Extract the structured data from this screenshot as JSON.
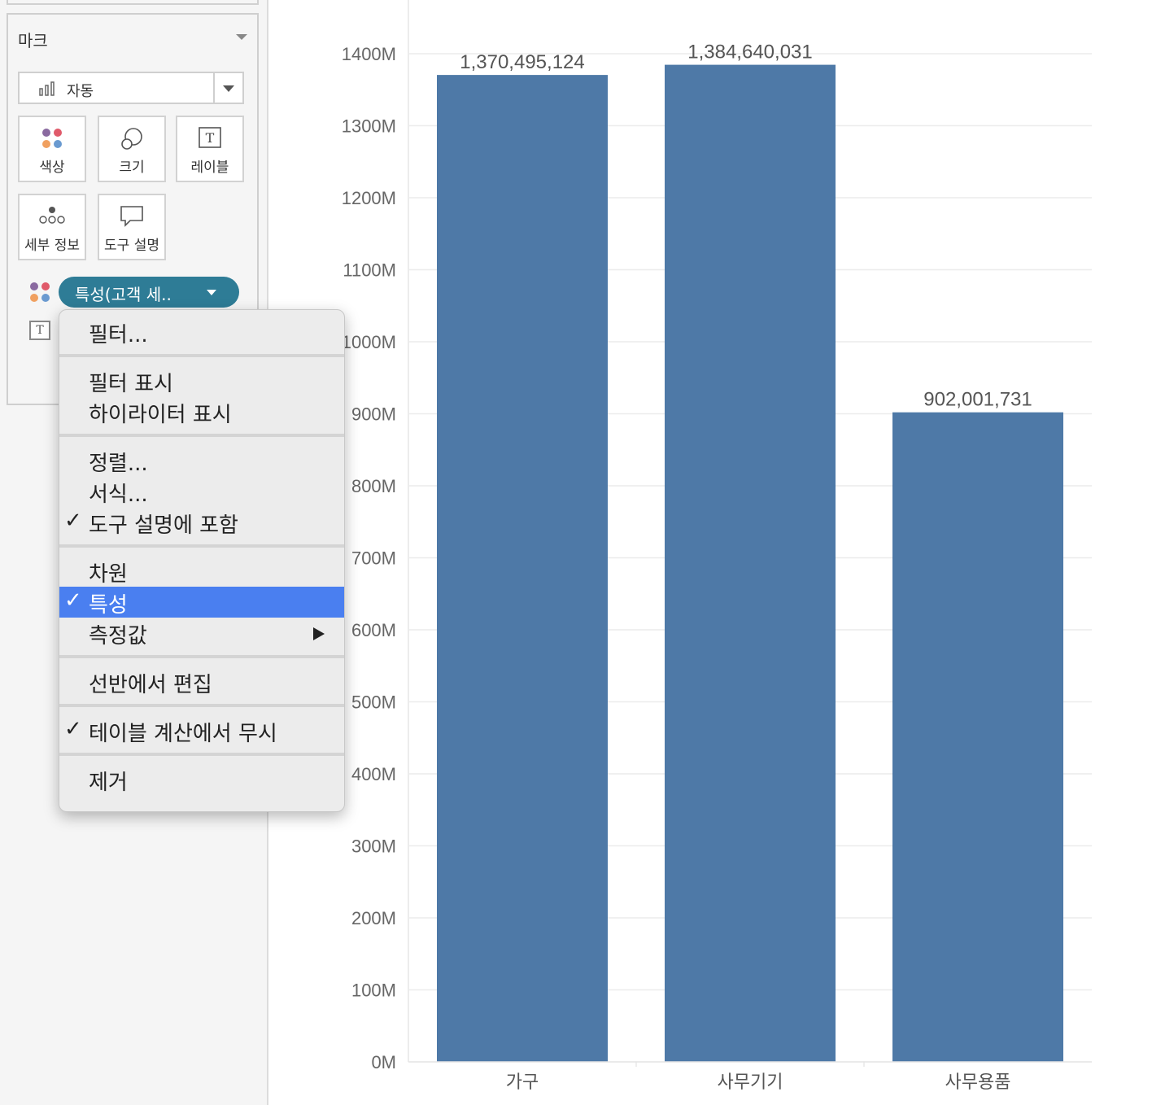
{
  "marks_panel": {
    "title": "마크",
    "mark_type": "자동",
    "tiles": [
      "색상",
      "크기",
      "레이블",
      "세부 정보",
      "도구 설명"
    ],
    "pill_label": "특성(고객 세.."
  },
  "context_menu": {
    "groups": [
      [
        {
          "label": "필터...",
          "checked": false
        }
      ],
      [
        {
          "label": "필터 표시",
          "checked": false
        },
        {
          "label": "하이라이터 표시",
          "checked": false
        }
      ],
      [
        {
          "label": "정렬...",
          "checked": false
        },
        {
          "label": "서식...",
          "checked": false
        },
        {
          "label": "도구 설명에 포함",
          "checked": true
        }
      ],
      [
        {
          "label": "차원",
          "checked": false
        },
        {
          "label": "특성",
          "checked": true,
          "selected": true
        },
        {
          "label": "측정값",
          "checked": false,
          "submenu": true
        }
      ],
      [
        {
          "label": "선반에서 편집",
          "checked": false
        }
      ],
      [
        {
          "label": "테이블 계산에서 무시",
          "checked": true
        }
      ],
      [
        {
          "label": "제거",
          "checked": false
        }
      ]
    ]
  },
  "chart_data": {
    "type": "bar",
    "categories": [
      "가구",
      "사무기기",
      "사무용품"
    ],
    "values": [
      1370495124,
      1384640031,
      902001731
    ],
    "data_labels": [
      "1,370,495,124",
      "1,384,640,031",
      "902,001,731"
    ],
    "y_ticks": [
      "0M",
      "100M",
      "200M",
      "300M",
      "400M",
      "500M",
      "600M",
      "700M",
      "800M",
      "900M",
      "1000M",
      "1100M",
      "1200M",
      "1300M",
      "1400M"
    ],
    "ylim": [
      0,
      1400000000
    ],
    "bar_color": "#4e79a7",
    "grid": true
  }
}
